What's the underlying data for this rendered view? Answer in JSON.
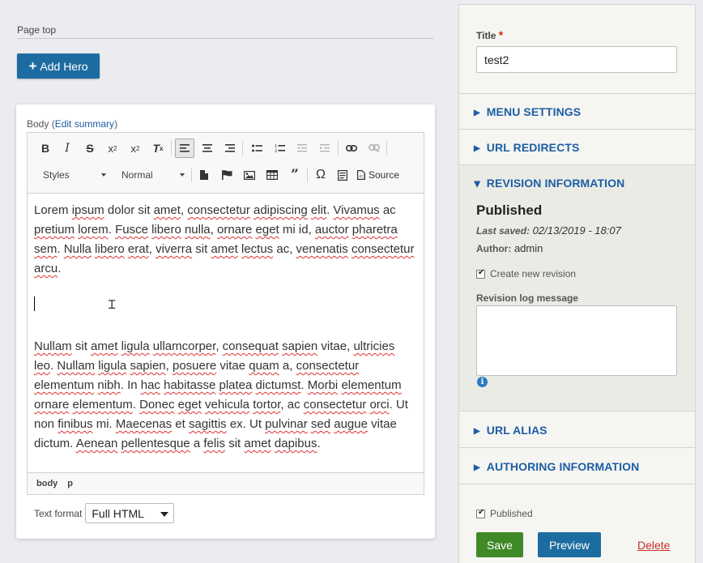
{
  "page_top": {
    "label": "Page top",
    "add_hero_label": "Add Hero"
  },
  "body_field": {
    "label": "Body",
    "edit_summary": "Edit summary",
    "styles_combo": "Styles",
    "format_combo": "Normal",
    "source_label": "Source",
    "paragraphs": [
      [
        {
          "t": "Lorem",
          "s": false
        },
        {
          "t": " "
        },
        {
          "t": "ipsum",
          "s": true
        },
        {
          "t": " dolor sit "
        },
        {
          "t": "amet",
          "s": true
        },
        {
          "t": ", "
        },
        {
          "t": "consectetur",
          "s": true
        },
        {
          "t": " "
        },
        {
          "t": "adipiscing",
          "s": true
        },
        {
          "t": " "
        },
        {
          "t": "elit",
          "s": true
        },
        {
          "t": ". "
        },
        {
          "t": "Vivamus",
          "s": true
        },
        {
          "t": " ac "
        },
        {
          "t": "pretium",
          "s": true
        },
        {
          "t": " "
        },
        {
          "t": "lorem",
          "s": true
        },
        {
          "t": ". "
        },
        {
          "t": "Fusce",
          "s": true
        },
        {
          "t": " "
        },
        {
          "t": "libero",
          "s": true
        },
        {
          "t": " "
        },
        {
          "t": "nulla",
          "s": true
        },
        {
          "t": ", "
        },
        {
          "t": "ornare",
          "s": true
        },
        {
          "t": " "
        },
        {
          "t": "eget",
          "s": true
        },
        {
          "t": " mi id, "
        },
        {
          "t": "auctor",
          "s": true
        },
        {
          "t": " "
        },
        {
          "t": "pharetra",
          "s": true
        },
        {
          "t": " "
        },
        {
          "t": "sem",
          "s": true
        },
        {
          "t": ". "
        },
        {
          "t": "Nulla",
          "s": true
        },
        {
          "t": " "
        },
        {
          "t": "libero",
          "s": true
        },
        {
          "t": " "
        },
        {
          "t": "erat",
          "s": true
        },
        {
          "t": ", "
        },
        {
          "t": "viverra",
          "s": true
        },
        {
          "t": " sit "
        },
        {
          "t": "amet",
          "s": true
        },
        {
          "t": " "
        },
        {
          "t": "lectus",
          "s": true
        },
        {
          "t": " ac, "
        },
        {
          "t": "venenatis",
          "s": true
        },
        {
          "t": " "
        },
        {
          "t": "consectetur",
          "s": true
        },
        {
          "t": " "
        },
        {
          "t": "arcu",
          "s": true
        },
        {
          "t": "."
        }
      ],
      [
        {
          "t": "Nullam",
          "s": true
        },
        {
          "t": " sit "
        },
        {
          "t": "amet",
          "s": true
        },
        {
          "t": " "
        },
        {
          "t": "ligula",
          "s": true
        },
        {
          "t": " "
        },
        {
          "t": "ullamcorper",
          "s": true
        },
        {
          "t": ", "
        },
        {
          "t": "consequat",
          "s": true
        },
        {
          "t": " "
        },
        {
          "t": "sapien",
          "s": true
        },
        {
          "t": " vitae, "
        },
        {
          "t": "ultricies",
          "s": true
        },
        {
          "t": " "
        },
        {
          "t": "leo",
          "s": true
        },
        {
          "t": ". "
        },
        {
          "t": "Nullam",
          "s": true
        },
        {
          "t": " "
        },
        {
          "t": "ligula",
          "s": true
        },
        {
          "t": " "
        },
        {
          "t": "sapien",
          "s": true
        },
        {
          "t": ", "
        },
        {
          "t": "posuere",
          "s": true
        },
        {
          "t": " vitae "
        },
        {
          "t": "quam",
          "s": true
        },
        {
          "t": " a, "
        },
        {
          "t": "consectetur",
          "s": true
        },
        {
          "t": " "
        },
        {
          "t": "elementum",
          "s": true
        },
        {
          "t": " "
        },
        {
          "t": "nibh",
          "s": true
        },
        {
          "t": ". In "
        },
        {
          "t": "hac",
          "s": true
        },
        {
          "t": " "
        },
        {
          "t": "habitasse",
          "s": true
        },
        {
          "t": " "
        },
        {
          "t": "platea",
          "s": true
        },
        {
          "t": " "
        },
        {
          "t": "dictumst",
          "s": true
        },
        {
          "t": ". "
        },
        {
          "t": "Morbi",
          "s": true
        },
        {
          "t": " "
        },
        {
          "t": "elementum",
          "s": true
        },
        {
          "t": " "
        },
        {
          "t": "ornare",
          "s": true
        },
        {
          "t": " "
        },
        {
          "t": "elementum",
          "s": true
        },
        {
          "t": ". "
        },
        {
          "t": "Donec",
          "s": true
        },
        {
          "t": " "
        },
        {
          "t": "eget",
          "s": true
        },
        {
          "t": " "
        },
        {
          "t": "vehicula",
          "s": true
        },
        {
          "t": " "
        },
        {
          "t": "tortor",
          "s": true
        },
        {
          "t": ", ac "
        },
        {
          "t": "consectetur",
          "s": true
        },
        {
          "t": " "
        },
        {
          "t": "orci",
          "s": true
        },
        {
          "t": ". Ut non "
        },
        {
          "t": "finibus",
          "s": true
        },
        {
          "t": " mi. "
        },
        {
          "t": "Maecenas",
          "s": true
        },
        {
          "t": " et "
        },
        {
          "t": "sagittis",
          "s": true
        },
        {
          "t": " ex. Ut "
        },
        {
          "t": "pulvinar",
          "s": true
        },
        {
          "t": " "
        },
        {
          "t": "sed",
          "s": true
        },
        {
          "t": " "
        },
        {
          "t": "augue",
          "s": true
        },
        {
          "t": " vitae dictum. "
        },
        {
          "t": "Aenean",
          "s": true
        },
        {
          "t": " "
        },
        {
          "t": "pellentesque",
          "s": true
        },
        {
          "t": " a "
        },
        {
          "t": "felis",
          "s": true
        },
        {
          "t": " sit "
        },
        {
          "t": "amet",
          "s": true
        },
        {
          "t": " "
        },
        {
          "t": "dapibus",
          "s": true
        },
        {
          "t": "."
        }
      ]
    ],
    "path": [
      "body",
      "p"
    ],
    "text_format_label": "Text format",
    "text_format_value": "Full HTML"
  },
  "sidebar": {
    "title_label": "Title",
    "required_mark": "*",
    "title_value": "test2",
    "menu_settings": "MENU SETTINGS",
    "url_redirects": "URL REDIRECTS",
    "revision_information": "REVISION INFORMATION",
    "status": "Published",
    "last_saved_label": "Last saved:",
    "last_saved_value": "02/13/2019 - 18:07",
    "author_label": "Author:",
    "author_value": "admin",
    "create_revision_label": "Create new revision",
    "log_label": "Revision log message",
    "info_glyph": "i",
    "url_alias": "URL ALIAS",
    "authoring_information": "AUTHORING INFORMATION",
    "published_label": "Published",
    "save_label": "Save",
    "preview_label": "Preview",
    "delete_label": "Delete"
  },
  "colors": {
    "primary": "#1d6ca1",
    "save": "#3f8a27",
    "delete": "#c9302c",
    "link": "#1d5ea3"
  }
}
